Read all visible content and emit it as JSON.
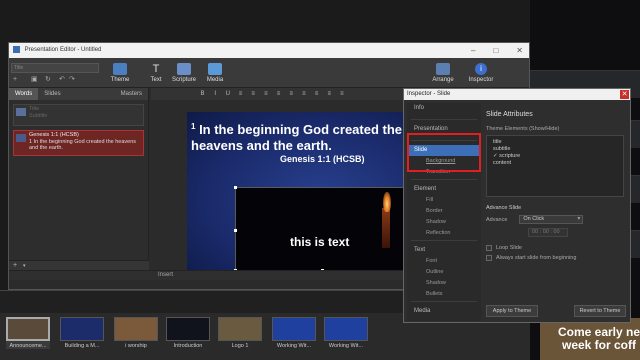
{
  "editor": {
    "title": "Presentation Editor - Untitled",
    "title_field_placeholder": "Title",
    "toolbar": {
      "theme": "Theme",
      "text": "Text",
      "scripture": "Scripture",
      "media": "Media",
      "arrange": "Arrange",
      "inspector": "Inspector"
    },
    "left_tabs": {
      "words": "Words",
      "slides": "Slides",
      "masters": "Masters"
    },
    "slides": [
      {
        "title": "Title",
        "sub": "Subtitle"
      },
      {
        "title": "Genesis 1:1 (HCSB)",
        "sub": "1 In the beginning God created the heavens and the earth."
      }
    ],
    "insert_label": "Insert",
    "slide_canvas": {
      "verse_number": "1",
      "verse": " In the beginning God created the heavens and the earth.",
      "reference": "Genesis 1:1 (HCSB)",
      "textbox_text": "this is text"
    }
  },
  "library": [
    {
      "label": "Announceme...",
      "color": "#5a4a3a",
      "selected": true
    },
    {
      "label": "Building a M...",
      "color": "#1c2b6a"
    },
    {
      "label": "i worship",
      "color": "#7a5a3a"
    },
    {
      "label": "Introduction",
      "color": "#10131c"
    },
    {
      "label": "Logo 1",
      "color": "#6a5a40"
    },
    {
      "label": "Working Wit...",
      "color": "#2040a0"
    },
    {
      "label": "Working Wit...",
      "color": "#2040a0"
    }
  ],
  "inspector": {
    "title": "Inspector - Slide",
    "nav": {
      "info": "Info",
      "presentation": "Presentation",
      "slide": "Slide",
      "background": "Background",
      "transition": "Transition",
      "element": "Element",
      "fill": "Fill",
      "border": "Border",
      "shadow": "Shadow",
      "reflection": "Reflection",
      "text": "Text",
      "font": "Font",
      "outline": "Outline",
      "text_shadow": "Shadow",
      "bullets": "Bullets",
      "media": "Media"
    },
    "heading": "Slide Attributes",
    "theme_elements_label": "Theme Elements (Show/Hide)",
    "theme_elements": [
      "title",
      "subtitle",
      "✓ scripture",
      "content"
    ],
    "advance_heading": "Advance Slide",
    "advance_label": "Advance",
    "advance_value": "On Click",
    "time_value": "00 : 00 : 00",
    "loop_label": "Loop Slide",
    "always_start_label": "Always start slide from beginning",
    "apply_button": "Apply to Theme",
    "revert_button": "Revert to Theme"
  },
  "desktop": {
    "promo_text": "Come early ne week for coff"
  },
  "colors": {
    "accent": "#3c6fb8",
    "highlight": "#e02020"
  }
}
